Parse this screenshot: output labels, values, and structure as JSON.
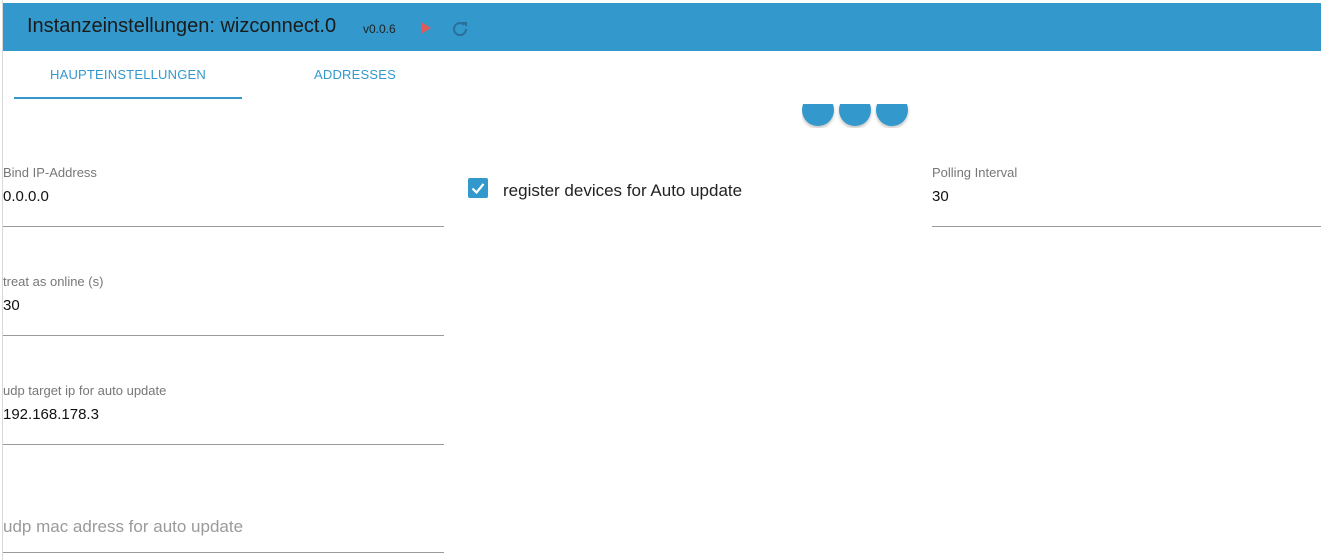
{
  "header": {
    "title": "Instanzeinstellungen: wizconnect.0",
    "version": "v0.0.6",
    "icons": {
      "start": "play-icon",
      "reload": "reload-icon"
    },
    "colors": {
      "bar": "#3399cc",
      "play": "#e05a5a",
      "reload": "#2a6f99"
    }
  },
  "tabs": [
    {
      "label": "HAUPTEINSTELLUNGEN",
      "selected": true
    },
    {
      "label": "ADDRESSES",
      "selected": false
    }
  ],
  "fields": {
    "bind_ip": {
      "label": "Bind IP-Address",
      "value": "0.0.0.0"
    },
    "polling_interval": {
      "label": "Polling Interval",
      "value": "30"
    },
    "treat_online": {
      "label": "treat as online (s)",
      "value": "30"
    },
    "udp_target_ip": {
      "label": "udp target ip for auto update",
      "value": "192.168.178.3"
    },
    "udp_mac": {
      "placeholder": "udp mac adress for auto update",
      "value": ""
    }
  },
  "checkbox": {
    "label": "register devices for Auto update",
    "checked": true
  }
}
